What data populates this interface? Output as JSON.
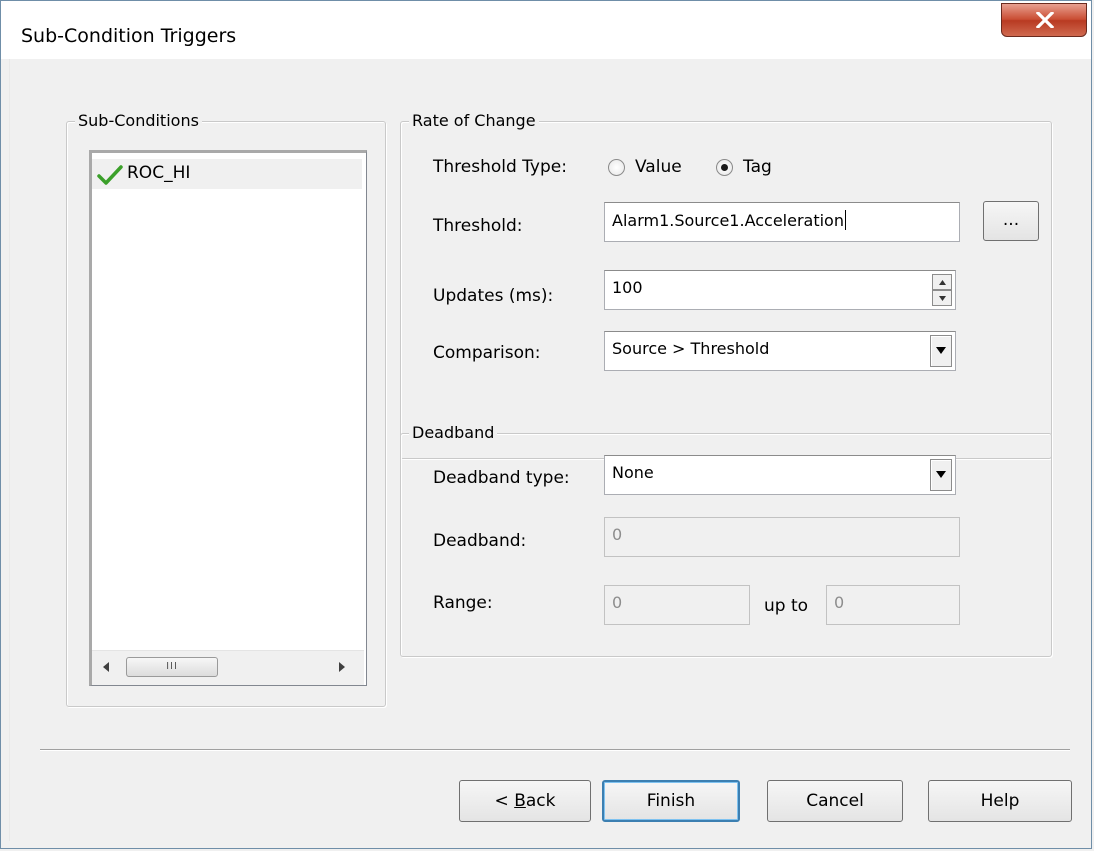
{
  "window": {
    "title": "Sub-Condition Triggers"
  },
  "sub_conditions": {
    "legend": "Sub-Conditions",
    "items": [
      {
        "label": "ROC_HI",
        "checked": true
      }
    ],
    "scroll_thumb_grip": "III"
  },
  "rate_of_change": {
    "legend": "Rate of Change",
    "threshold_type_label": "Threshold Type:",
    "options": [
      {
        "label": "Value",
        "selected": false
      },
      {
        "label": "Tag",
        "selected": true
      }
    ],
    "threshold_label": "Threshold:",
    "threshold_value": "Alarm1.Source1.Acceleration",
    "browse_label": "...",
    "updates_label": "Updates (ms):",
    "updates_value": "100",
    "comparison_label": "Comparison:",
    "comparison_value": "Source > Threshold"
  },
  "deadband": {
    "legend": "Deadband",
    "type_label": "Deadband type:",
    "type_value": "None",
    "deadband_label": "Deadband:",
    "deadband_value": "0",
    "range_label": "Range:",
    "range_from": "0",
    "up_to_label": "up to",
    "range_to": "0"
  },
  "buttons": {
    "back_prefix": "< ",
    "back_mnemonic": "B",
    "back_rest": "ack",
    "finish": "Finish",
    "cancel": "Cancel",
    "help": "Help"
  },
  "colors": {
    "check_green": "#3ba02a",
    "close_red": "#c94d33",
    "default_button_border": "#3c7fb1"
  }
}
